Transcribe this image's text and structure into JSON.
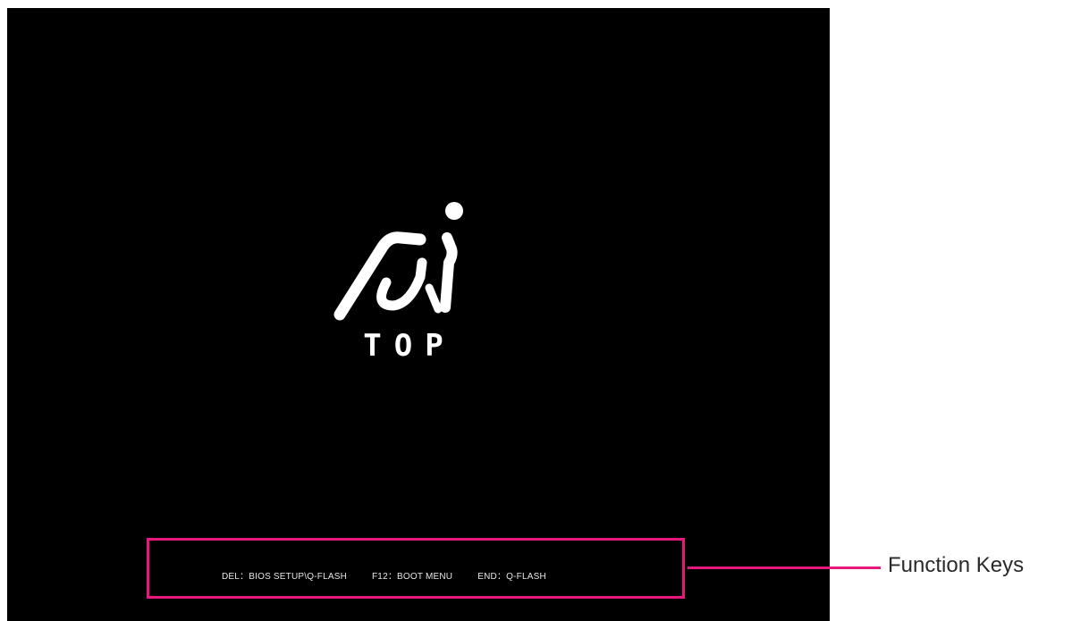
{
  "screen": {
    "logo": {
      "icon": "ai-top-logo-icon",
      "text": "TOP"
    },
    "function_keys": [
      {
        "label": "DEL：BIOS SETUP\\Q-FLASH"
      },
      {
        "label": "F12：BOOT MENU"
      },
      {
        "label": "END：Q-FLASH"
      }
    ]
  },
  "annotation": {
    "label": "Function Keys",
    "color": "#e6177d"
  }
}
